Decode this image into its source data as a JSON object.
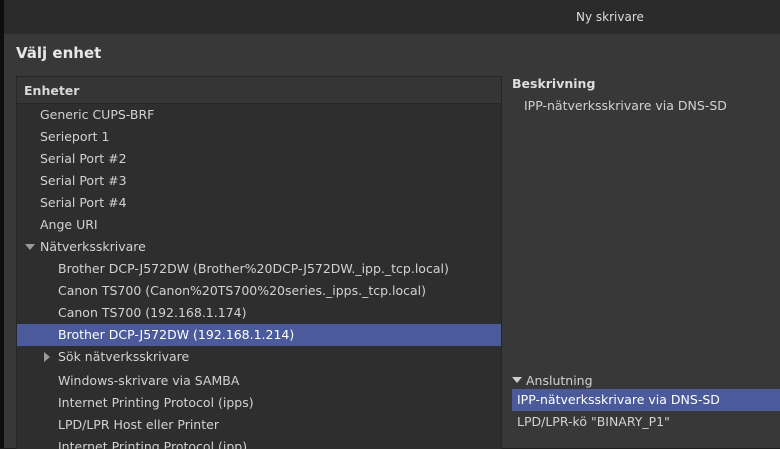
{
  "window": {
    "title": "Ny skrivare"
  },
  "heading": "Välj enhet",
  "device_list": {
    "header": "Enheter",
    "items": [
      {
        "label": "Generic CUPS-BRF"
      },
      {
        "label": "Serieport 1"
      },
      {
        "label": "Serial Port #2"
      },
      {
        "label": "Serial Port #3"
      },
      {
        "label": "Serial Port #4"
      },
      {
        "label": "Ange URI"
      },
      {
        "label": "Nätverksskrivare"
      },
      {
        "label": "Brother DCP-J572DW (Brother%20DCP-J572DW._ipp._tcp.local)"
      },
      {
        "label": "Canon TS700 (Canon%20TS700%20series._ipps._tcp.local)"
      },
      {
        "label": "Canon TS700 (192.168.1.174)"
      },
      {
        "label": "Brother DCP-J572DW (192.168.1.214)"
      },
      {
        "label": "Sök nätverksskrivare"
      },
      {
        "label": "Windows-skrivare via SAMBA"
      },
      {
        "label": "Internet Printing Protocol (ipps)"
      },
      {
        "label": "LPD/LPR Host eller Printer"
      },
      {
        "label": "Internet Printing Protocol (ipp)"
      }
    ]
  },
  "description": {
    "label": "Beskrivning",
    "value": "IPP-nätverksskrivare via DNS-SD"
  },
  "connection": {
    "label": "Anslutning",
    "items": [
      {
        "label": "IPP-nätverksskrivare via DNS-SD"
      },
      {
        "label": "LPD/LPR-kö \"BINARY_P1\""
      }
    ]
  },
  "colors": {
    "selection": "#4a5a9a",
    "window_bg": "#383838",
    "list_bg": "#2e2e2e"
  },
  "icons": {
    "expanded": "triangle-down-icon",
    "collapsed": "triangle-right-icon"
  }
}
